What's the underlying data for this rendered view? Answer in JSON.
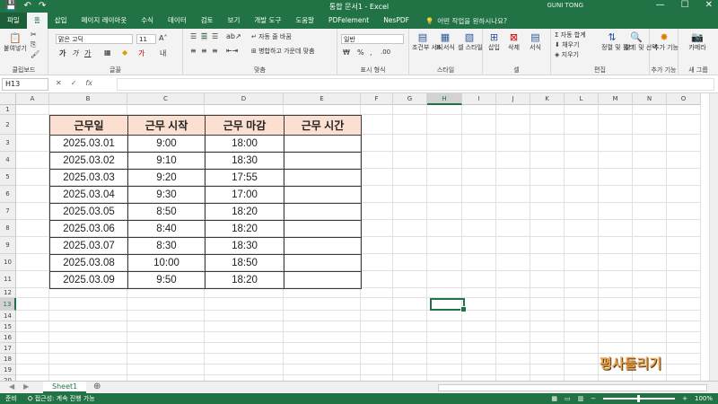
{
  "titlebar": {
    "title": "통합 문서1  -  Excel",
    "user": "GUNI TONG",
    "qat": [
      "💾",
      "↶",
      "↷"
    ],
    "win_buttons": [
      "—",
      "☐",
      "✕"
    ]
  },
  "tabs": [
    "파일",
    "홈",
    "삽입",
    "페이지 레이아웃",
    "수식",
    "데이터",
    "검토",
    "보기",
    "개발 도구",
    "도움말",
    "PDFelement",
    "NesPDF"
  ],
  "tellme": "어떤 작업을 원하시나요?",
  "ribbon": {
    "groups": {
      "clipboard": "클립보드",
      "font": "글꼴",
      "align": "맞춤",
      "number": "표시 형식",
      "style": "스타일",
      "cells": "셀",
      "edit": "편집",
      "addin": "추가 기능",
      "camera": "새 그룹"
    },
    "paste": "붙여넣기",
    "font_name": "맑은 고딕",
    "font_size": "11",
    "wrap_text": "자동 줄 바꿈",
    "merge": "병합하고 가운데 맞춤",
    "number_format": "일반",
    "cond_format": "조건부 서식",
    "table_format": "표 서식",
    "cell_style": "셀 스타일",
    "insert": "삽입",
    "delete": "삭제",
    "format": "서식",
    "autosum": "자동 합계",
    "fill": "채우기",
    "clear": "지우기",
    "sort_filter": "정렬 및 필터",
    "find_select": "찾기 및 선택",
    "addin_label": "추가 기능",
    "camera_label": "카메라"
  },
  "formula_bar": {
    "name_box": "H13",
    "fx": "fx",
    "value": ""
  },
  "columns": [
    "A",
    "B",
    "C",
    "D",
    "E",
    "F",
    "G",
    "H",
    "I",
    "J",
    "K",
    "L",
    "M",
    "N",
    "O"
  ],
  "selected_column": "H",
  "rows": [
    "1",
    "2",
    "3",
    "4",
    "5",
    "6",
    "7",
    "8",
    "9",
    "10",
    "11",
    "12",
    "13",
    "14",
    "15",
    "16",
    "17",
    "18",
    "19",
    "20"
  ],
  "selected_row": "13",
  "table": {
    "headers": [
      "근무일",
      "근무 시작",
      "근무 마감",
      "근무 시간"
    ],
    "rows": [
      [
        "2025.03.01",
        "9:00",
        "18:00",
        ""
      ],
      [
        "2025.03.02",
        "9:10",
        "18:30",
        ""
      ],
      [
        "2025.03.03",
        "9:20",
        "17:55",
        ""
      ],
      [
        "2025.03.04",
        "9:30",
        "17:00",
        ""
      ],
      [
        "2025.03.05",
        "8:50",
        "18:20",
        ""
      ],
      [
        "2025.03.06",
        "8:40",
        "18:20",
        ""
      ],
      [
        "2025.03.07",
        "8:30",
        "18:30",
        ""
      ],
      [
        "2025.03.08",
        "10:00",
        "18:50",
        ""
      ],
      [
        "2025.03.09",
        "9:50",
        "18:20",
        ""
      ]
    ]
  },
  "watermark": "평사돌리기",
  "sheet_tab": "Sheet1",
  "statusbar": {
    "ready": "준비",
    "accessibility": "접근성: 계속 진행 가능",
    "zoom": "100%"
  }
}
